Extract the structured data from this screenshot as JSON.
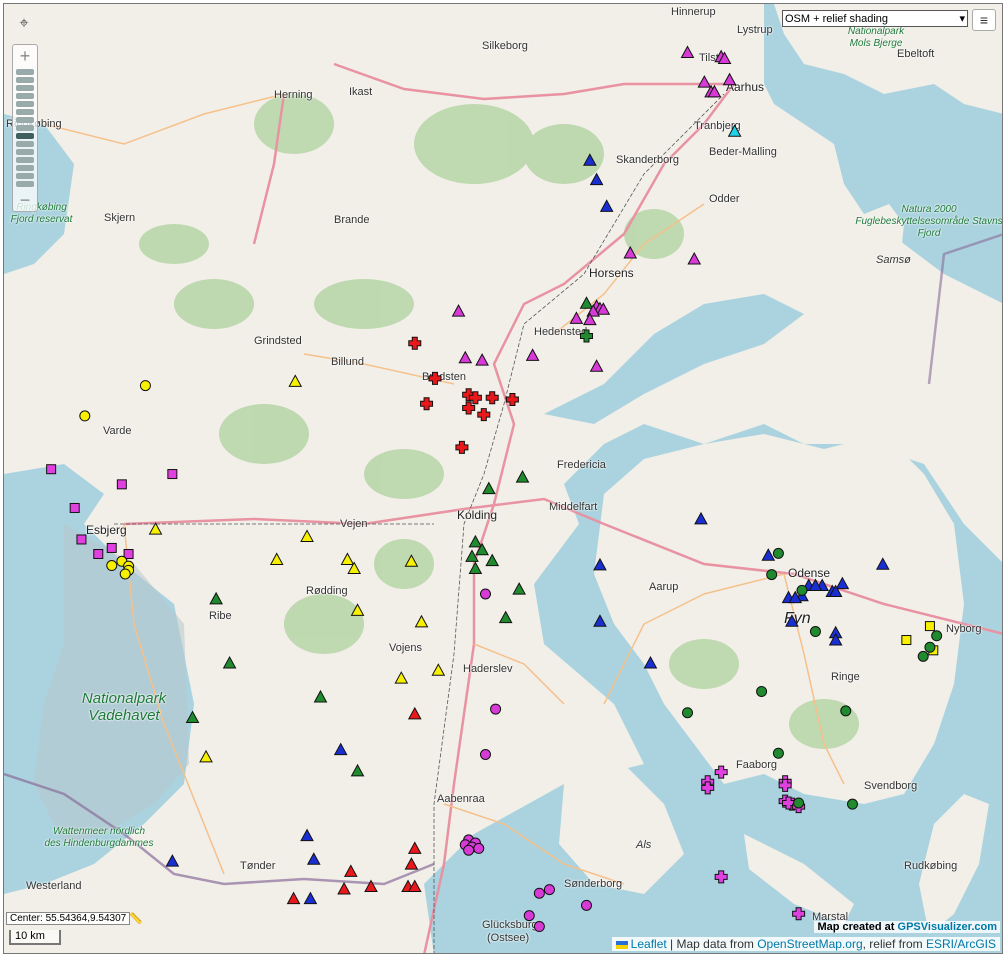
{
  "layer_select": {
    "value": "OSM + relief shading"
  },
  "controls": {
    "zoom_in": "+",
    "zoom_out": "−",
    "crosshair": "⌖",
    "menu": "≡"
  },
  "status": {
    "center": "Center: 55.54364,9.54307",
    "ruler": "📏",
    "scale": "10 km"
  },
  "credits": {
    "made_prefix": "Map created at",
    "made_link": "GPSVisualizer.com",
    "leaflet": "Leaflet",
    "map_data_prefix": "| Map data from",
    "osm": "OpenStreetMap.org",
    "relief_prefix": ", relief from",
    "relief": "ESRI/ArcGIS"
  },
  "labels": {
    "hinnerup": "Hinnerup",
    "lystrup": "Lystrup",
    "silkeborg": "Silkeborg",
    "tilst": "Tilst",
    "ebeltoft": "Ebeltoft",
    "herning": "Herning",
    "ikast": "Ikast",
    "aarhus": "Aarhus",
    "ringkobing": "Ringkøbing",
    "tranbjerg": "Tranbjerg",
    "skanderborg": "Skanderborg",
    "beder": "Beder-Malling",
    "odder": "Odder",
    "skjern": "Skjern",
    "brande": "Brande",
    "horsens": "Horsens",
    "samso": "Samsø",
    "hedensted": "Hedensted",
    "grindsted": "Grindsted",
    "billund": "Billund",
    "bredsten": "Bredsten",
    "varde": "Varde",
    "fredericia": "Fredericia",
    "kolding": "Kolding",
    "middelfart": "Middelfart",
    "esbjerg": "Esbjerg",
    "vejen": "Vejen",
    "odense": "Odense",
    "rodding": "Rødding",
    "aarup": "Aarup",
    "ribe": "Ribe",
    "fyn": "Fyn",
    "nyborg": "Nyborg",
    "vojens": "Vojens",
    "haderslev": "Haderslev",
    "ringe": "Ringe",
    "faaborg": "Faaborg",
    "aabenraa": "Aabenraa",
    "svendborg": "Svendborg",
    "als": "Als",
    "tonder": "Tønder",
    "rudkobing": "Rudkøbing",
    "sonderborg": "Sønderborg",
    "westerland": "Westerland",
    "marstal": "Marstal",
    "glucksburg": "Glücksburg",
    "ostsee": "(Ostsee)",
    "np_mols": "Nationalpark Mols Bjerge",
    "np_vadehavet": "Nationalpark Vadehavet",
    "wattenmeer": "Wattenmeer nördlich des Hindenburgdammes",
    "natura": "Natura 2000 Fuglebeskyttelsesområde Stavns Fjord",
    "ringk_reservat": "Ringkøbing Fjord reservat"
  },
  "colors": {
    "land": "#f2efe9",
    "sea": "#aad3df",
    "forest": "#add19e",
    "motorway": "#e892a2",
    "primary": "#fcd6a4",
    "border": "#8a6d9a",
    "red": "#e8181b",
    "magenta": "#d83ad8",
    "blue": "#1a2fd2",
    "green": "#1f8a2e",
    "yellow": "#f7f000",
    "cyan": "#1fd2e8",
    "pink": "#e040e0"
  },
  "markers": [
    {
      "shape": "triangle",
      "color": "magenta",
      "lat": 56.27,
      "lon": 10.06
    },
    {
      "shape": "triangle",
      "color": "magenta",
      "lat": 56.263,
      "lon": 10.16
    },
    {
      "shape": "triangle",
      "color": "magenta",
      "lat": 56.26,
      "lon": 10.17
    },
    {
      "shape": "triangle",
      "color": "magenta",
      "lat": 56.225,
      "lon": 10.185
    },
    {
      "shape": "triangle",
      "color": "magenta",
      "lat": 56.221,
      "lon": 10.11
    },
    {
      "shape": "triangle",
      "color": "magenta",
      "lat": 56.205,
      "lon": 10.13
    },
    {
      "shape": "triangle",
      "color": "magenta",
      "lat": 56.205,
      "lon": 10.14
    },
    {
      "shape": "triangle",
      "color": "cyan",
      "lat": 56.14,
      "lon": 10.2
    },
    {
      "shape": "triangle",
      "color": "blue",
      "lat": 56.092,
      "lon": 9.77
    },
    {
      "shape": "triangle",
      "color": "blue",
      "lat": 56.06,
      "lon": 9.79
    },
    {
      "shape": "triangle",
      "color": "blue",
      "lat": 56.016,
      "lon": 9.82
    },
    {
      "shape": "triangle",
      "color": "magenta",
      "lat": 55.939,
      "lon": 9.89
    },
    {
      "shape": "triangle",
      "color": "magenta",
      "lat": 55.929,
      "lon": 10.08
    },
    {
      "shape": "triangle",
      "color": "green",
      "lat": 55.856,
      "lon": 9.76
    },
    {
      "shape": "triangle",
      "color": "magenta",
      "lat": 55.851,
      "lon": 9.79
    },
    {
      "shape": "triangle",
      "color": "magenta",
      "lat": 55.847,
      "lon": 9.8
    },
    {
      "shape": "triangle",
      "color": "magenta",
      "lat": 55.846,
      "lon": 9.81
    },
    {
      "shape": "triangle",
      "color": "magenta",
      "lat": 55.843,
      "lon": 9.78
    },
    {
      "shape": "triangle",
      "color": "magenta",
      "lat": 55.831,
      "lon": 9.73
    },
    {
      "shape": "triangle",
      "color": "magenta",
      "lat": 55.829,
      "lon": 9.77
    },
    {
      "shape": "cross",
      "color": "green",
      "lat": 55.802,
      "lon": 9.76
    },
    {
      "shape": "triangle",
      "color": "magenta",
      "lat": 55.843,
      "lon": 9.38
    },
    {
      "shape": "triangle",
      "color": "magenta",
      "lat": 55.766,
      "lon": 9.4
    },
    {
      "shape": "triangle",
      "color": "magenta",
      "lat": 55.762,
      "lon": 9.45
    },
    {
      "shape": "triangle",
      "color": "magenta",
      "lat": 55.77,
      "lon": 9.6
    },
    {
      "shape": "triangle",
      "color": "magenta",
      "lat": 55.752,
      "lon": 9.79
    },
    {
      "shape": "cross",
      "color": "red",
      "lat": 55.79,
      "lon": 9.25
    },
    {
      "shape": "cross",
      "color": "red",
      "lat": 55.732,
      "lon": 9.31
    },
    {
      "shape": "cross",
      "color": "red",
      "lat": 55.705,
      "lon": 9.41
    },
    {
      "shape": "cross",
      "color": "red",
      "lat": 55.7,
      "lon": 9.43
    },
    {
      "shape": "cross",
      "color": "red",
      "lat": 55.7,
      "lon": 9.48
    },
    {
      "shape": "cross",
      "color": "red",
      "lat": 55.697,
      "lon": 9.54
    },
    {
      "shape": "cross",
      "color": "red",
      "lat": 55.69,
      "lon": 9.285
    },
    {
      "shape": "cross",
      "color": "red",
      "lat": 55.683,
      "lon": 9.41
    },
    {
      "shape": "cross",
      "color": "red",
      "lat": 55.672,
      "lon": 9.455
    },
    {
      "shape": "cross",
      "color": "red",
      "lat": 55.618,
      "lon": 9.39
    },
    {
      "shape": "triangle",
      "color": "yellow",
      "lat": 55.727,
      "lon": 8.895
    },
    {
      "shape": "circle",
      "color": "yellow",
      "lat": 55.72,
      "lon": 8.45
    },
    {
      "shape": "circle",
      "color": "yellow",
      "lat": 55.67,
      "lon": 8.27
    },
    {
      "shape": "square",
      "color": "pink",
      "lat": 55.582,
      "lon": 8.17
    },
    {
      "shape": "square",
      "color": "pink",
      "lat": 55.574,
      "lon": 8.53
    },
    {
      "shape": "square",
      "color": "pink",
      "lat": 55.557,
      "lon": 8.38
    },
    {
      "shape": "square",
      "color": "pink",
      "lat": 55.518,
      "lon": 8.24
    },
    {
      "shape": "triangle",
      "color": "yellow",
      "lat": 55.483,
      "lon": 8.48
    },
    {
      "shape": "triangle",
      "color": "yellow",
      "lat": 55.471,
      "lon": 8.93
    },
    {
      "shape": "square",
      "color": "pink",
      "lat": 55.466,
      "lon": 8.26
    },
    {
      "shape": "square",
      "color": "pink",
      "lat": 55.452,
      "lon": 8.35
    },
    {
      "shape": "square",
      "color": "pink",
      "lat": 55.442,
      "lon": 8.31
    },
    {
      "shape": "square",
      "color": "pink",
      "lat": 55.442,
      "lon": 8.4
    },
    {
      "shape": "circle",
      "color": "yellow",
      "lat": 55.43,
      "lon": 8.38
    },
    {
      "shape": "circle",
      "color": "yellow",
      "lat": 55.423,
      "lon": 8.35
    },
    {
      "shape": "circle",
      "color": "yellow",
      "lat": 55.422,
      "lon": 8.4
    },
    {
      "shape": "circle",
      "color": "yellow",
      "lat": 55.415,
      "lon": 8.4
    },
    {
      "shape": "circle",
      "color": "yellow",
      "lat": 55.409,
      "lon": 8.39
    },
    {
      "shape": "triangle",
      "color": "yellow",
      "lat": 55.433,
      "lon": 8.84
    },
    {
      "shape": "triangle",
      "color": "yellow",
      "lat": 55.433,
      "lon": 9.05
    },
    {
      "shape": "triangle",
      "color": "yellow",
      "lat": 55.43,
      "lon": 9.24
    },
    {
      "shape": "triangle",
      "color": "yellow",
      "lat": 55.418,
      "lon": 9.07
    },
    {
      "shape": "triangle",
      "color": "green",
      "lat": 55.462,
      "lon": 9.43
    },
    {
      "shape": "triangle",
      "color": "green",
      "lat": 55.449,
      "lon": 9.45
    },
    {
      "shape": "triangle",
      "color": "green",
      "lat": 55.438,
      "lon": 9.42
    },
    {
      "shape": "triangle",
      "color": "green",
      "lat": 55.431,
      "lon": 9.48
    },
    {
      "shape": "triangle",
      "color": "green",
      "lat": 55.418,
      "lon": 9.43
    },
    {
      "shape": "triangle",
      "color": "green",
      "lat": 55.55,
      "lon": 9.47
    },
    {
      "shape": "triangle",
      "color": "green",
      "lat": 55.569,
      "lon": 9.57
    },
    {
      "shape": "circle",
      "color": "magenta",
      "lat": 55.376,
      "lon": 9.46
    },
    {
      "shape": "triangle",
      "color": "green",
      "lat": 55.384,
      "lon": 9.56
    },
    {
      "shape": "triangle",
      "color": "green",
      "lat": 55.368,
      "lon": 8.66
    },
    {
      "shape": "triangle",
      "color": "yellow",
      "lat": 55.349,
      "lon": 9.08
    },
    {
      "shape": "triangle",
      "color": "green",
      "lat": 55.337,
      "lon": 9.52
    },
    {
      "shape": "triangle",
      "color": "yellow",
      "lat": 55.33,
      "lon": 9.27
    },
    {
      "shape": "triangle",
      "color": "green",
      "lat": 55.262,
      "lon": 8.7
    },
    {
      "shape": "triangle",
      "color": "yellow",
      "lat": 55.25,
      "lon": 9.32
    },
    {
      "shape": "triangle",
      "color": "yellow",
      "lat": 55.237,
      "lon": 9.21
    },
    {
      "shape": "triangle",
      "color": "green",
      "lat": 55.206,
      "lon": 8.97
    },
    {
      "shape": "circle",
      "color": "magenta",
      "lat": 55.186,
      "lon": 9.49
    },
    {
      "shape": "triangle",
      "color": "red",
      "lat": 55.178,
      "lon": 9.25
    },
    {
      "shape": "triangle",
      "color": "green",
      "lat": 55.172,
      "lon": 8.59
    },
    {
      "shape": "triangle",
      "color": "yellow",
      "lat": 55.107,
      "lon": 8.63
    },
    {
      "shape": "triangle",
      "color": "blue",
      "lat": 55.119,
      "lon": 9.03
    },
    {
      "shape": "circle",
      "color": "magenta",
      "lat": 55.111,
      "lon": 9.46
    },
    {
      "shape": "triangle",
      "color": "green",
      "lat": 55.084,
      "lon": 9.08
    },
    {
      "shape": "triangle",
      "color": "blue",
      "lat": 54.977,
      "lon": 8.93
    },
    {
      "shape": "triangle",
      "color": "red",
      "lat": 54.956,
      "lon": 9.25
    },
    {
      "shape": "triangle",
      "color": "blue",
      "lat": 54.938,
      "lon": 8.95
    },
    {
      "shape": "triangle",
      "color": "blue",
      "lat": 54.935,
      "lon": 8.53
    },
    {
      "shape": "triangle",
      "color": "red",
      "lat": 54.93,
      "lon": 9.24
    },
    {
      "shape": "triangle",
      "color": "red",
      "lat": 54.918,
      "lon": 9.06
    },
    {
      "shape": "circle",
      "color": "magenta",
      "lat": 54.97,
      "lon": 9.41
    },
    {
      "shape": "circle",
      "color": "magenta",
      "lat": 54.965,
      "lon": 9.43
    },
    {
      "shape": "circle",
      "color": "magenta",
      "lat": 54.962,
      "lon": 9.4
    },
    {
      "shape": "circle",
      "color": "magenta",
      "lat": 54.958,
      "lon": 9.42
    },
    {
      "shape": "circle",
      "color": "magenta",
      "lat": 54.956,
      "lon": 9.44
    },
    {
      "shape": "circle",
      "color": "magenta",
      "lat": 54.953,
      "lon": 9.41
    },
    {
      "shape": "triangle",
      "color": "red",
      "lat": 54.893,
      "lon": 9.12
    },
    {
      "shape": "triangle",
      "color": "red",
      "lat": 54.893,
      "lon": 9.23
    },
    {
      "shape": "triangle",
      "color": "red",
      "lat": 54.893,
      "lon": 9.25
    },
    {
      "shape": "triangle",
      "color": "red",
      "lat": 54.889,
      "lon": 9.04
    },
    {
      "shape": "triangle",
      "color": "blue",
      "lat": 54.873,
      "lon": 8.94
    },
    {
      "shape": "triangle",
      "color": "red",
      "lat": 54.873,
      "lon": 8.89
    },
    {
      "shape": "circle",
      "color": "magenta",
      "lat": 54.888,
      "lon": 9.65
    },
    {
      "shape": "circle",
      "color": "magenta",
      "lat": 54.882,
      "lon": 9.62
    },
    {
      "shape": "circle",
      "color": "magenta",
      "lat": 54.862,
      "lon": 9.76
    },
    {
      "shape": "circle",
      "color": "magenta",
      "lat": 54.845,
      "lon": 9.59
    },
    {
      "shape": "circle",
      "color": "magenta",
      "lat": 54.827,
      "lon": 9.62
    },
    {
      "shape": "triangle",
      "color": "blue",
      "lat": 55.5,
      "lon": 10.1
    },
    {
      "shape": "triangle",
      "color": "blue",
      "lat": 55.44,
      "lon": 10.3
    },
    {
      "shape": "circle",
      "color": "green",
      "lat": 55.443,
      "lon": 10.33
    },
    {
      "shape": "circle",
      "color": "green",
      "lat": 55.408,
      "lon": 10.31
    },
    {
      "shape": "triangle",
      "color": "blue",
      "lat": 55.424,
      "lon": 9.8
    },
    {
      "shape": "triangle",
      "color": "blue",
      "lat": 55.425,
      "lon": 10.64
    },
    {
      "shape": "triangle",
      "color": "blue",
      "lat": 55.393,
      "lon": 10.52
    },
    {
      "shape": "triangle",
      "color": "blue",
      "lat": 55.39,
      "lon": 10.46
    },
    {
      "shape": "triangle",
      "color": "blue",
      "lat": 55.39,
      "lon": 10.42
    },
    {
      "shape": "triangle",
      "color": "blue",
      "lat": 55.39,
      "lon": 10.44
    },
    {
      "shape": "triangle",
      "color": "blue",
      "lat": 55.38,
      "lon": 10.49
    },
    {
      "shape": "triangle",
      "color": "blue",
      "lat": 55.38,
      "lon": 10.5
    },
    {
      "shape": "triangle",
      "color": "blue",
      "lat": 55.373,
      "lon": 10.4
    },
    {
      "shape": "triangle",
      "color": "blue",
      "lat": 55.37,
      "lon": 10.36
    },
    {
      "shape": "triangle",
      "color": "blue",
      "lat": 55.37,
      "lon": 10.38
    },
    {
      "shape": "circle",
      "color": "green",
      "lat": 55.382,
      "lon": 10.4
    },
    {
      "shape": "triangle",
      "color": "blue",
      "lat": 55.331,
      "lon": 9.8
    },
    {
      "shape": "triangle",
      "color": "blue",
      "lat": 55.331,
      "lon": 10.37
    },
    {
      "shape": "circle",
      "color": "green",
      "lat": 55.314,
      "lon": 10.44
    },
    {
      "shape": "triangle",
      "color": "blue",
      "lat": 55.312,
      "lon": 10.5
    },
    {
      "shape": "triangle",
      "color": "blue",
      "lat": 55.3,
      "lon": 10.5
    },
    {
      "shape": "triangle",
      "color": "blue",
      "lat": 55.262,
      "lon": 9.95
    },
    {
      "shape": "square",
      "color": "yellow",
      "lat": 55.323,
      "lon": 10.78
    },
    {
      "shape": "square",
      "color": "yellow",
      "lat": 55.3,
      "lon": 10.71
    },
    {
      "shape": "square",
      "color": "yellow",
      "lat": 55.283,
      "lon": 10.79
    },
    {
      "shape": "circle",
      "color": "green",
      "lat": 55.307,
      "lon": 10.8
    },
    {
      "shape": "circle",
      "color": "green",
      "lat": 55.288,
      "lon": 10.78
    },
    {
      "shape": "circle",
      "color": "green",
      "lat": 55.273,
      "lon": 10.76
    },
    {
      "shape": "circle",
      "color": "green",
      "lat": 55.215,
      "lon": 10.28
    },
    {
      "shape": "circle",
      "color": "green",
      "lat": 55.183,
      "lon": 10.53
    },
    {
      "shape": "circle",
      "color": "green",
      "lat": 55.18,
      "lon": 10.06
    },
    {
      "shape": "circle",
      "color": "green",
      "lat": 55.113,
      "lon": 10.33
    },
    {
      "shape": "cross",
      "color": "pink",
      "lat": 55.082,
      "lon": 10.16
    },
    {
      "shape": "cross",
      "color": "pink",
      "lat": 55.066,
      "lon": 10.12
    },
    {
      "shape": "cross",
      "color": "pink",
      "lat": 55.056,
      "lon": 10.12
    },
    {
      "shape": "cross",
      "color": "pink",
      "lat": 55.066,
      "lon": 10.35
    },
    {
      "shape": "cross",
      "color": "pink",
      "lat": 55.06,
      "lon": 10.35
    },
    {
      "shape": "cross",
      "color": "pink",
      "lat": 55.034,
      "lon": 10.35
    },
    {
      "shape": "cross",
      "color": "pink",
      "lat": 55.029,
      "lon": 10.37
    },
    {
      "shape": "cross",
      "color": "pink",
      "lat": 55.031,
      "lon": 10.36
    },
    {
      "shape": "cross",
      "color": "pink",
      "lat": 55.025,
      "lon": 10.39
    },
    {
      "shape": "circle",
      "color": "green",
      "lat": 55.031,
      "lon": 10.39
    },
    {
      "shape": "circle",
      "color": "green",
      "lat": 55.029,
      "lon": 10.55
    },
    {
      "shape": "cross",
      "color": "pink",
      "lat": 54.909,
      "lon": 10.16
    },
    {
      "shape": "cross",
      "color": "pink",
      "lat": 54.848,
      "lon": 10.39
    }
  ]
}
